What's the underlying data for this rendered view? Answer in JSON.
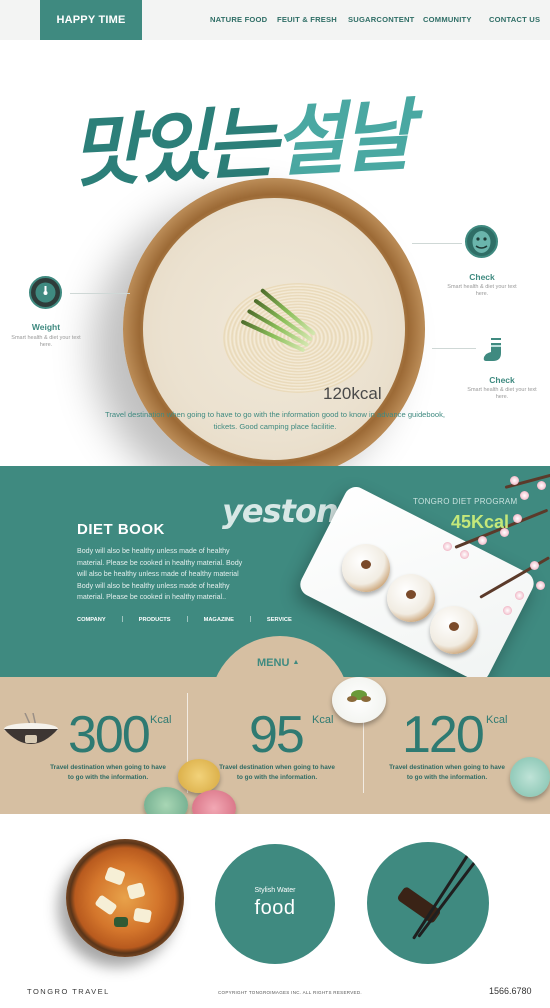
{
  "header": {
    "logo": "HAPPY TIME",
    "nav": [
      "NATURE FOOD",
      "FEUIT & FRESH",
      "SUGARCONTENT",
      "COMMUNITY",
      "CONTACT US"
    ]
  },
  "hero": {
    "korean_title_1": "맛있는",
    "korean_title_2": "설날",
    "kcal": "120kcal",
    "description": "Travel destination when going to have to go with the information good to know in advance guidebook, tickets. Good camping place facilitie.",
    "weight_title": "Weight",
    "weight_sub": "Smart health & diet your text here.",
    "check1_title": "Check",
    "check1_sub": "Smart health & diet your text here.",
    "check2_title": "Check",
    "check2_sub": "Smart health & diet your text here."
  },
  "diet": {
    "watermark": "yestone",
    "title": "DIET BOOK",
    "body": "Body will also be healthy unless made of healthy material. Please be cooked in healthy material. Body will also be healthy unless made of healthy material Body will also be healthy unless made of healthy material. Please be cooked in healthy material..",
    "links": [
      "COMPANY",
      "PRODUCTS",
      "MAGAZINE",
      "SERVICE"
    ],
    "program_label": "TONGRO DIET PROGRAM",
    "program_kcal": "45Kcal"
  },
  "menu": {
    "label": "MENU",
    "stats": [
      {
        "value": "300",
        "unit": "Kcal",
        "desc": "Travel destination when going to have to go with the information."
      },
      {
        "value": "95",
        "unit": "Kcal",
        "desc": "Travel destination when going to have to go with the information."
      },
      {
        "value": "120",
        "unit": "Kcal",
        "desc": "Travel destination when going to have to go with the information."
      }
    ]
  },
  "bottom": {
    "water_sub": "Stylish Water",
    "water_main": "food"
  },
  "footer": {
    "left": "TONGRO TRAVEL",
    "mid": "COPYRIGHT TONGROIMAGES INC. ALL RIGHTS RESERVED.",
    "right": "1566.6780"
  },
  "colors": {
    "teal": "#3f8a80",
    "beige": "#d6bfa2",
    "lime": "#c4e87a"
  }
}
